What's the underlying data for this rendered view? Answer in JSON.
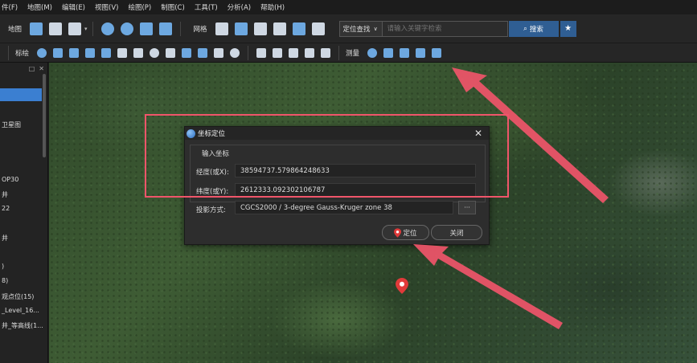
{
  "menubar": {
    "items": [
      "件(F)",
      "地图(M)",
      "编辑(E)",
      "视图(V)",
      "绘图(P)",
      "制图(C)",
      "工具(T)",
      "分析(A)",
      "帮助(H)"
    ]
  },
  "toolbar1": {
    "map_label": "地图",
    "grid_label": "网格",
    "search": {
      "mode": "定位查找",
      "placeholder": "请输入关键字检索",
      "button": "搜索"
    }
  },
  "toolbar2": {
    "draw_label": "标绘",
    "measure_label": "测量"
  },
  "sidebar": {
    "items": [
      "卫星图",
      "OP30",
      "井",
      "22",
      "井",
      ")",
      "8)",
      "观点位(15)",
      "_Level_16...",
      "井_等高线(1..."
    ]
  },
  "dialog": {
    "title": "坐标定位",
    "group_label": "输入坐标",
    "lon_label": "经度(或X):",
    "lon_value": "38594737.579864248633",
    "lat_label": "纬度(或Y):",
    "lat_value": "2612333.092302106787",
    "proj_label": "投影方式:",
    "proj_value": "CGCS2000 / 3-degree Gauss-Kruger zone 38",
    "dots": "···",
    "locate_btn": "定位",
    "close_btn": "关闭"
  },
  "colors": {
    "accent": "#2f5e93",
    "annotation": "#f0556a",
    "pin": "#e03a3a"
  }
}
